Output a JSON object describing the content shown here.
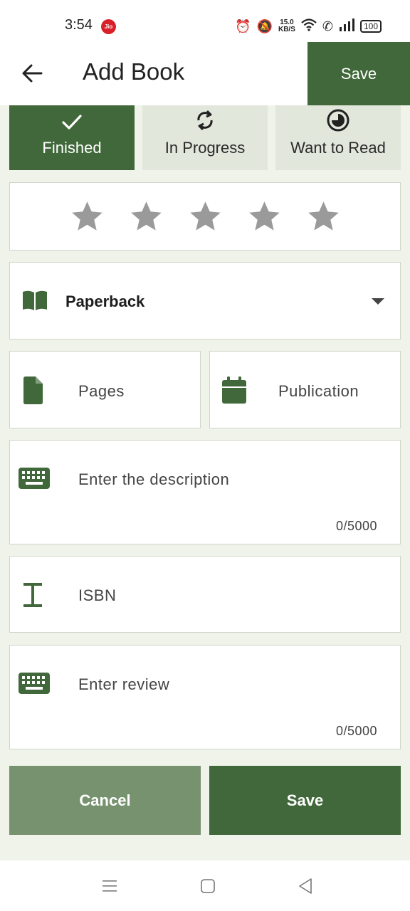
{
  "status_bar": {
    "time": "3:54",
    "carrier_badge": "Jio",
    "speed_value": "15.0",
    "speed_unit": "KB/S",
    "battery": "100"
  },
  "app_bar": {
    "title": "Add Book",
    "save_label": "Save",
    "back_icon": "arrow-left-icon"
  },
  "reading_status": {
    "selected": "Finished",
    "options": [
      {
        "label": "Finished",
        "icon": "check-icon"
      },
      {
        "label": "In Progress",
        "icon": "refresh-icon"
      },
      {
        "label": "Want to Read",
        "icon": "half-circle-icon"
      }
    ]
  },
  "rating": {
    "stars_total": 5,
    "stars_filled": 0,
    "star_color": "#9a9a9a"
  },
  "format": {
    "selected": "Paperback",
    "icon": "open-book-icon"
  },
  "pages": {
    "placeholder": "Pages",
    "icon": "file-icon"
  },
  "publication": {
    "placeholder": "Publication",
    "icon": "calendar-icon"
  },
  "description": {
    "placeholder": "Enter the description",
    "counter": "0/5000",
    "icon": "keyboard-icon"
  },
  "isbn": {
    "placeholder": "ISBN",
    "icon": "text-cursor-icon"
  },
  "review": {
    "placeholder": "Enter review",
    "counter": "0/5000",
    "icon": "keyboard-icon"
  },
  "actions": {
    "cancel_label": "Cancel",
    "save_label": "Save"
  },
  "colors": {
    "primary": "#41683a",
    "primary_light": "#77926f",
    "segment_bg": "#e2e7dc",
    "page_bg": "#f0f3ea"
  }
}
